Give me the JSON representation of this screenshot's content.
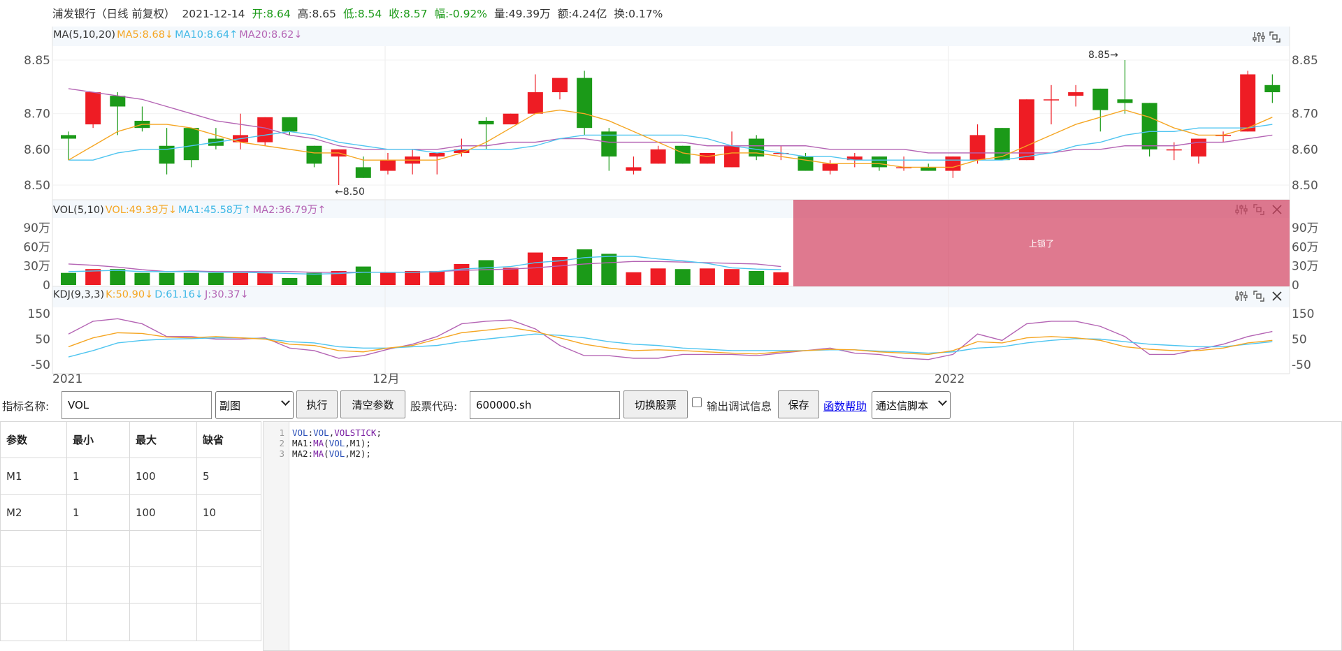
{
  "info": {
    "name_period": "浦发银行（日线 前复权）",
    "date": "2021-12-14",
    "open": "开:8.64",
    "high": "高:8.65",
    "low": "低:8.54",
    "close": "收:8.57",
    "change": "幅:-0.92%",
    "volume": "量:49.39万",
    "amount": "额:4.24亿",
    "turnover": "换:0.17%"
  },
  "colors": {
    "up": "#ee1c24",
    "down": "#1b9a18",
    "ma5": "#f5a623",
    "ma10": "#4fc5f0",
    "ma20": "#b464b4",
    "lock": "#d34564"
  },
  "ma_header": {
    "title": "MA(5,10,20)",
    "ma5": "MA5:8.68↓",
    "ma10": "MA10:8.64↑",
    "ma20": "MA20:8.62↓"
  },
  "vol_header": {
    "title": "VOL(5,10)",
    "vol": "VOL:49.39万↓",
    "ma1": "MA1:45.58万↑",
    "ma2": "MA2:36.79万↑"
  },
  "kdj_header": {
    "title": "KDJ(9,3,3)",
    "k": "K:50.90↓",
    "d": "D:61.16↓",
    "j": "J:30.37↓"
  },
  "price_axis": [
    "8.85",
    "8.70",
    "8.60",
    "8.50"
  ],
  "vol_axis": [
    "90万",
    "60万",
    "30万",
    "0"
  ],
  "kdj_axis": [
    "150",
    "50",
    "-50"
  ],
  "date_axis": [
    "2021",
    "12月",
    "2022"
  ],
  "max_marker": "8.85→",
  "min_marker": "←8.50",
  "lock_text": "上锁了",
  "icons": [
    "settings-icon",
    "fullscreen-icon",
    "close-icon"
  ],
  "chart_data": {
    "type": "candlestick",
    "ohlc": [
      [
        8.64,
        8.65,
        8.57,
        8.63
      ],
      [
        8.67,
        8.76,
        8.66,
        8.76
      ],
      [
        8.75,
        8.76,
        8.64,
        8.72
      ],
      [
        8.68,
        8.72,
        8.65,
        8.66
      ],
      [
        8.61,
        8.66,
        8.53,
        8.56
      ],
      [
        8.66,
        8.66,
        8.55,
        8.57
      ],
      [
        8.63,
        8.66,
        8.6,
        8.61
      ],
      [
        8.62,
        8.7,
        8.6,
        8.64
      ],
      [
        8.62,
        8.69,
        8.61,
        8.69
      ],
      [
        8.69,
        8.69,
        8.64,
        8.65
      ],
      [
        8.61,
        8.61,
        8.55,
        8.56
      ],
      [
        8.58,
        8.6,
        8.5,
        8.6
      ],
      [
        8.55,
        8.58,
        8.52,
        8.52
      ],
      [
        8.54,
        8.59,
        8.53,
        8.57
      ],
      [
        8.56,
        8.6,
        8.53,
        8.58
      ],
      [
        8.58,
        8.59,
        8.53,
        8.59
      ],
      [
        8.59,
        8.63,
        8.58,
        8.6
      ],
      [
        8.68,
        8.69,
        8.6,
        8.67
      ],
      [
        8.67,
        8.7,
        8.67,
        8.7
      ],
      [
        8.7,
        8.81,
        8.7,
        8.76
      ],
      [
        8.76,
        8.79,
        8.74,
        8.8
      ],
      [
        8.8,
        8.82,
        8.64,
        8.66
      ],
      [
        8.65,
        8.66,
        8.54,
        8.58
      ],
      [
        8.54,
        8.58,
        8.53,
        8.55
      ],
      [
        8.56,
        8.61,
        8.56,
        8.6
      ],
      [
        8.61,
        8.61,
        8.56,
        8.56
      ],
      [
        8.56,
        8.59,
        8.56,
        8.59
      ],
      [
        8.55,
        8.65,
        8.55,
        8.61
      ],
      [
        8.63,
        8.64,
        8.57,
        8.58
      ],
      [
        8.59,
        8.61,
        8.57,
        8.59
      ],
      [
        8.58,
        8.59,
        8.54,
        8.54
      ],
      [
        8.54,
        8.57,
        8.53,
        8.56
      ],
      [
        8.57,
        8.59,
        8.55,
        8.58
      ],
      [
        8.58,
        8.58,
        8.54,
        8.55
      ],
      [
        8.55,
        8.58,
        8.54,
        8.55
      ],
      [
        8.55,
        8.56,
        8.54,
        8.54
      ],
      [
        8.54,
        8.58,
        8.52,
        8.58
      ],
      [
        8.57,
        8.67,
        8.56,
        8.64
      ],
      [
        8.66,
        8.66,
        8.57,
        8.57
      ],
      [
        8.57,
        8.74,
        8.57,
        8.74
      ],
      [
        8.74,
        8.78,
        8.67,
        8.74
      ],
      [
        8.75,
        8.78,
        8.72,
        8.76
      ],
      [
        8.77,
        8.77,
        8.65,
        8.71
      ],
      [
        8.74,
        8.85,
        8.7,
        8.73
      ],
      [
        8.73,
        8.73,
        8.58,
        8.6
      ],
      [
        8.6,
        8.62,
        8.57,
        8.6
      ],
      [
        8.58,
        8.63,
        8.56,
        8.63
      ],
      [
        8.64,
        8.65,
        8.62,
        8.64
      ],
      [
        8.65,
        8.82,
        8.65,
        8.81
      ],
      [
        8.78,
        8.81,
        8.73,
        8.76
      ]
    ],
    "ma5": [
      8.57,
      8.61,
      8.65,
      8.67,
      8.67,
      8.66,
      8.64,
      8.62,
      8.61,
      8.6,
      8.59,
      8.59,
      8.57,
      8.57,
      8.57,
      8.57,
      8.59,
      8.62,
      8.66,
      8.7,
      8.71,
      8.7,
      8.68,
      8.65,
      8.62,
      8.59,
      8.58,
      8.59,
      8.59,
      8.58,
      8.57,
      8.56,
      8.56,
      8.56,
      8.55,
      8.55,
      8.55,
      8.57,
      8.58,
      8.61,
      8.64,
      8.67,
      8.69,
      8.71,
      8.69,
      8.66,
      8.64,
      8.64,
      8.66,
      8.69
    ],
    "ma10": [
      8.57,
      8.57,
      8.59,
      8.6,
      8.6,
      8.61,
      8.62,
      8.63,
      8.64,
      8.65,
      8.64,
      8.62,
      8.61,
      8.6,
      8.6,
      8.59,
      8.6,
      8.6,
      8.6,
      8.61,
      8.63,
      8.64,
      8.64,
      8.64,
      8.64,
      8.64,
      8.63,
      8.61,
      8.6,
      8.59,
      8.58,
      8.58,
      8.57,
      8.57,
      8.57,
      8.57,
      8.57,
      8.57,
      8.57,
      8.58,
      8.59,
      8.61,
      8.62,
      8.64,
      8.65,
      8.65,
      8.66,
      8.66,
      8.66,
      8.67
    ],
    "ma20": [
      8.77,
      8.76,
      8.75,
      8.74,
      8.72,
      8.7,
      8.68,
      8.67,
      8.66,
      8.64,
      8.63,
      8.61,
      8.6,
      8.6,
      8.6,
      8.6,
      8.61,
      8.61,
      8.62,
      8.62,
      8.63,
      8.63,
      8.62,
      8.62,
      8.62,
      8.62,
      8.61,
      8.61,
      8.61,
      8.61,
      8.61,
      8.6,
      8.6,
      8.6,
      8.6,
      8.59,
      8.59,
      8.59,
      8.59,
      8.59,
      8.59,
      8.6,
      8.6,
      8.61,
      8.61,
      8.61,
      8.62,
      8.62,
      8.63,
      8.64
    ],
    "volume": [
      19,
      25,
      25,
      19,
      19,
      19,
      19,
      19,
      19,
      11,
      19,
      22,
      29,
      19,
      22,
      22,
      33,
      39,
      27,
      51,
      44,
      56,
      49,
      20,
      26,
      25,
      26,
      25,
      22,
      20
    ],
    "vol_ma1": [
      21,
      22,
      23,
      21,
      21,
      21,
      20,
      20,
      19,
      18,
      17,
      18,
      20,
      20,
      20,
      21,
      25,
      27,
      29,
      35,
      38,
      43,
      45,
      45,
      41,
      38,
      34,
      27,
      25,
      24
    ],
    "vol_ma2": [
      33,
      31,
      28,
      24,
      21,
      22,
      21,
      21,
      21,
      21,
      20,
      20,
      20,
      20,
      20,
      21,
      23,
      24,
      25,
      27,
      30,
      33,
      35,
      37,
      37,
      36,
      35,
      34,
      33,
      29
    ],
    "kdj_k": [
      20,
      55,
      75,
      72,
      58,
      55,
      60,
      55,
      50,
      30,
      25,
      5,
      0,
      15,
      25,
      50,
      75,
      85,
      95,
      80,
      55,
      30,
      15,
      5,
      8,
      5,
      0,
      -5,
      -8,
      0,
      5,
      10,
      8,
      0,
      -5,
      -10,
      5,
      40,
      35,
      55,
      60,
      55,
      45,
      20,
      10,
      5,
      5,
      15,
      35,
      45
    ],
    "kdj_d": [
      -20,
      5,
      35,
      45,
      50,
      52,
      55,
      55,
      52,
      40,
      35,
      20,
      15,
      15,
      20,
      25,
      40,
      50,
      60,
      70,
      65,
      55,
      40,
      30,
      25,
      15,
      10,
      5,
      5,
      5,
      5,
      8,
      8,
      3,
      0,
      -5,
      0,
      15,
      20,
      35,
      45,
      52,
      50,
      40,
      30,
      25,
      20,
      20,
      30,
      40
    ],
    "kdj_j": [
      70,
      120,
      130,
      110,
      60,
      60,
      50,
      50,
      55,
      15,
      5,
      -25,
      -15,
      10,
      30,
      60,
      110,
      120,
      125,
      90,
      25,
      -15,
      -15,
      -25,
      -25,
      -10,
      -10,
      -10,
      -15,
      -5,
      5,
      15,
      -5,
      -10,
      -25,
      -30,
      -10,
      70,
      45,
      110,
      120,
      120,
      100,
      60,
      -10,
      -10,
      10,
      30,
      60,
      80
    ]
  },
  "form": {
    "indicator_label": "指标名称:",
    "indicator_value": "VOL",
    "panel_select": "副图",
    "run_button": "执行",
    "clear_button": "清空参数",
    "code_label": "股票代码:",
    "code_value": "600000.sh",
    "switch_button": "切换股票",
    "debug_label": "输出调试信息",
    "save_button": "保存",
    "help_link": "函数帮助",
    "script_select": "通达信脚本"
  },
  "params_table": {
    "headers": [
      "参数",
      "最小",
      "最大",
      "缺省"
    ],
    "rows": [
      [
        "M1",
        "1",
        "100",
        "5"
      ],
      [
        "M2",
        "1",
        "100",
        "10"
      ],
      [
        "",
        "",
        "",
        ""
      ],
      [
        "",
        "",
        "",
        ""
      ],
      [
        "",
        "",
        "",
        ""
      ]
    ]
  },
  "code_lines": [
    {
      "n": "1",
      "parts": [
        [
          "k1",
          "VOL"
        ],
        [
          "k3",
          ":"
        ],
        [
          "k1",
          "VOL"
        ],
        [
          "k3",
          ","
        ],
        [
          "k2",
          "VOLSTICK"
        ],
        [
          "k3",
          ";"
        ]
      ]
    },
    {
      "n": "2",
      "parts": [
        [
          "k3",
          "MA1:"
        ],
        [
          "k2",
          "MA"
        ],
        [
          "k3",
          "("
        ],
        [
          "k1",
          "VOL"
        ],
        [
          "k3",
          ",M1);"
        ]
      ]
    },
    {
      "n": "3",
      "parts": [
        [
          "k3",
          "MA2:"
        ],
        [
          "k2",
          "MA"
        ],
        [
          "k3",
          "("
        ],
        [
          "k1",
          "VOL"
        ],
        [
          "k3",
          ",M2);"
        ]
      ]
    }
  ]
}
